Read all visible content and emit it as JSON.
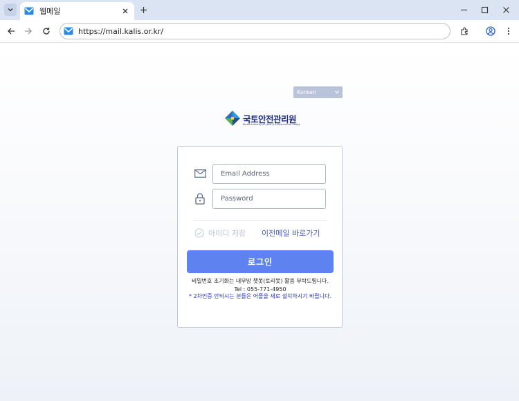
{
  "browser": {
    "tab_title": "웹메일",
    "url": "https://mail.kalis.or.kr/"
  },
  "icons": {
    "tab_search": "chevron-down-icon",
    "tab_favicon": "mail-icon",
    "tab_close": "close-icon",
    "new_tab": "plus-icon",
    "minimize": "minimize-icon",
    "maximize": "maximize-icon",
    "close_window": "close-icon",
    "back": "arrow-left-icon",
    "forward": "arrow-right-icon",
    "reload": "reload-icon",
    "extensions": "puzzle-icon",
    "profile": "profile-icon",
    "menu": "kebab-menu-icon",
    "email": "envelope-icon",
    "password": "lock-icon",
    "remember": "check-circle-icon"
  },
  "language": {
    "selected": "Korean"
  },
  "logo": {
    "name": "국토안전관리원",
    "subtitle": "Korea Authority of Land & Infrastructure Safety"
  },
  "form": {
    "email_placeholder": "Email Address",
    "password_placeholder": "Password",
    "remember_label": "아이디 저장",
    "prev_mail_link": "이전메일 바로가기",
    "login_button": "로그인"
  },
  "notice": {
    "line1": "비밀번호 초기화는 내부망 챗봇(토리봇) 활용 부탁드립니다.",
    "tel": "Tel : 055-771-4950",
    "warning": "* 2차인증 안되시는 분들은 어플을 새로 설치하시기 바랍니다."
  },
  "colors": {
    "tabstrip": "#dbe4f3",
    "accent": "#5e83f0",
    "link": "#4b5cb8",
    "warning": "#2230c9",
    "logo_navy": "#1b2d7a"
  }
}
